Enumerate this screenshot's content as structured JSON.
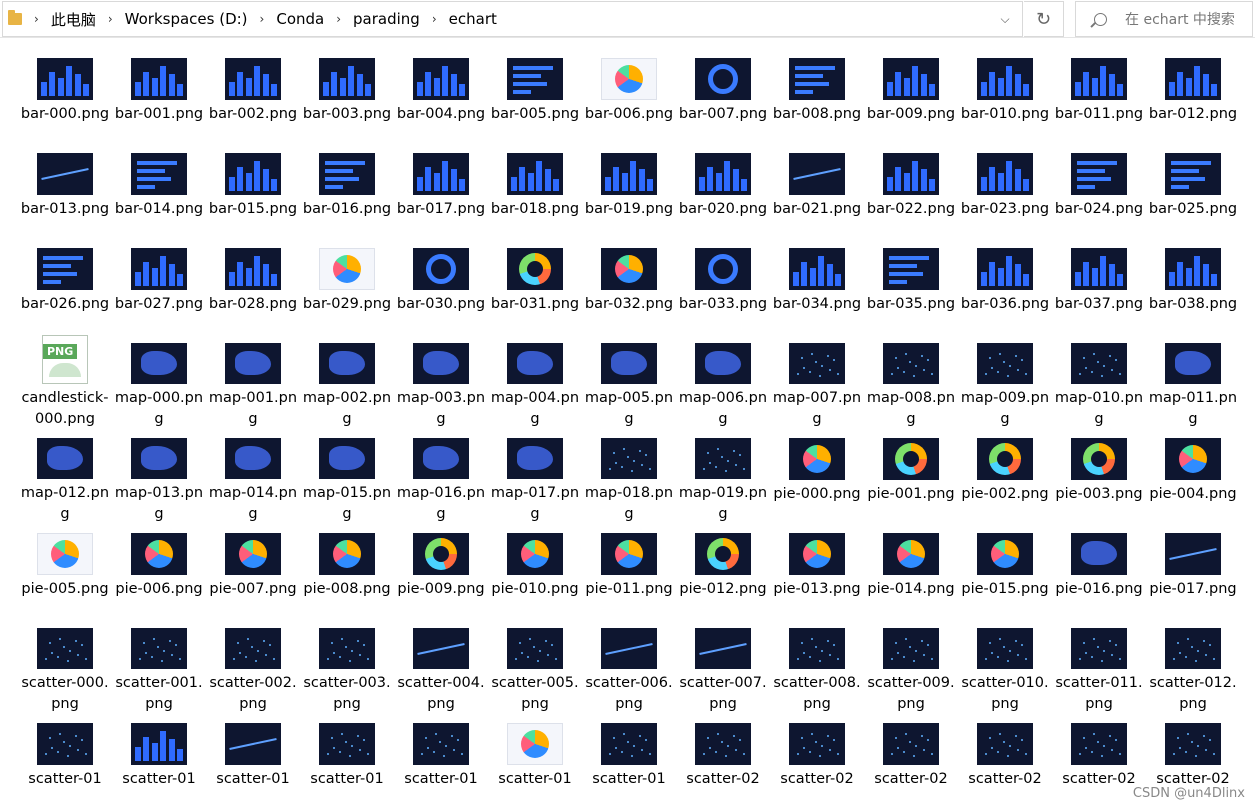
{
  "addressbar": {
    "crumbs": [
      "此电脑",
      "Workspaces (D:)",
      "Conda",
      "parading",
      "echart"
    ]
  },
  "search": {
    "placeholder": "在 echart 中搜索"
  },
  "files": [
    {
      "name": "bar-000.png",
      "kind": "bar"
    },
    {
      "name": "bar-001.png",
      "kind": "bar"
    },
    {
      "name": "bar-002.png",
      "kind": "bar"
    },
    {
      "name": "bar-003.png",
      "kind": "bar"
    },
    {
      "name": "bar-004.png",
      "kind": "bar"
    },
    {
      "name": "bar-005.png",
      "kind": "hbar"
    },
    {
      "name": "bar-006.png",
      "kind": "pie-light"
    },
    {
      "name": "bar-007.png",
      "kind": "ring"
    },
    {
      "name": "bar-008.png",
      "kind": "hbar"
    },
    {
      "name": "bar-009.png",
      "kind": "bar"
    },
    {
      "name": "bar-010.png",
      "kind": "bar"
    },
    {
      "name": "bar-011.png",
      "kind": "bar"
    },
    {
      "name": "bar-012.png",
      "kind": "bar"
    },
    {
      "name": "bar-013.png",
      "kind": "line"
    },
    {
      "name": "bar-014.png",
      "kind": "hbar"
    },
    {
      "name": "bar-015.png",
      "kind": "bar"
    },
    {
      "name": "bar-016.png",
      "kind": "hbar"
    },
    {
      "name": "bar-017.png",
      "kind": "bar"
    },
    {
      "name": "bar-018.png",
      "kind": "bar"
    },
    {
      "name": "bar-019.png",
      "kind": "bar"
    },
    {
      "name": "bar-020.png",
      "kind": "bar"
    },
    {
      "name": "bar-021.png",
      "kind": "line"
    },
    {
      "name": "bar-022.png",
      "kind": "bar"
    },
    {
      "name": "bar-023.png",
      "kind": "bar"
    },
    {
      "name": "bar-024.png",
      "kind": "hbar"
    },
    {
      "name": "bar-025.png",
      "kind": "hbar"
    },
    {
      "name": "bar-026.png",
      "kind": "hbar"
    },
    {
      "name": "bar-027.png",
      "kind": "bar"
    },
    {
      "name": "bar-028.png",
      "kind": "bar"
    },
    {
      "name": "bar-029.png",
      "kind": "pie-light"
    },
    {
      "name": "bar-030.png",
      "kind": "ring"
    },
    {
      "name": "bar-031.png",
      "kind": "donut"
    },
    {
      "name": "bar-032.png",
      "kind": "pie"
    },
    {
      "name": "bar-033.png",
      "kind": "ring"
    },
    {
      "name": "bar-034.png",
      "kind": "bar"
    },
    {
      "name": "bar-035.png",
      "kind": "hbar"
    },
    {
      "name": "bar-036.png",
      "kind": "bar"
    },
    {
      "name": "bar-037.png",
      "kind": "bar"
    },
    {
      "name": "bar-038.png",
      "kind": "bar"
    },
    {
      "name": "candlestick-000.png",
      "kind": "file"
    },
    {
      "name": "map-000.png",
      "kind": "map"
    },
    {
      "name": "map-001.png",
      "kind": "map"
    },
    {
      "name": "map-002.png",
      "kind": "map"
    },
    {
      "name": "map-003.png",
      "kind": "map"
    },
    {
      "name": "map-004.png",
      "kind": "map"
    },
    {
      "name": "map-005.png",
      "kind": "map"
    },
    {
      "name": "map-006.png",
      "kind": "map"
    },
    {
      "name": "map-007.png",
      "kind": "dots"
    },
    {
      "name": "map-008.png",
      "kind": "dots"
    },
    {
      "name": "map-009.png",
      "kind": "dots"
    },
    {
      "name": "map-010.png",
      "kind": "dots"
    },
    {
      "name": "map-011.png",
      "kind": "map"
    },
    {
      "name": "map-012.png",
      "kind": "map"
    },
    {
      "name": "map-013.png",
      "kind": "map"
    },
    {
      "name": "map-014.png",
      "kind": "map"
    },
    {
      "name": "map-015.png",
      "kind": "map"
    },
    {
      "name": "map-016.png",
      "kind": "map"
    },
    {
      "name": "map-017.png",
      "kind": "map"
    },
    {
      "name": "map-018.png",
      "kind": "dots"
    },
    {
      "name": "map-019.png",
      "kind": "dots"
    },
    {
      "name": "pie-000.png",
      "kind": "pie"
    },
    {
      "name": "pie-001.png",
      "kind": "donut"
    },
    {
      "name": "pie-002.png",
      "kind": "donut"
    },
    {
      "name": "pie-003.png",
      "kind": "donut"
    },
    {
      "name": "pie-004.png",
      "kind": "pie"
    },
    {
      "name": "pie-005.png",
      "kind": "pie-light"
    },
    {
      "name": "pie-006.png",
      "kind": "pie"
    },
    {
      "name": "pie-007.png",
      "kind": "pie"
    },
    {
      "name": "pie-008.png",
      "kind": "pie"
    },
    {
      "name": "pie-009.png",
      "kind": "donut"
    },
    {
      "name": "pie-010.png",
      "kind": "pie"
    },
    {
      "name": "pie-011.png",
      "kind": "pie"
    },
    {
      "name": "pie-012.png",
      "kind": "donut"
    },
    {
      "name": "pie-013.png",
      "kind": "pie"
    },
    {
      "name": "pie-014.png",
      "kind": "pie"
    },
    {
      "name": "pie-015.png",
      "kind": "pie"
    },
    {
      "name": "pie-016.png",
      "kind": "map"
    },
    {
      "name": "pie-017.png",
      "kind": "line"
    },
    {
      "name": "scatter-000.png",
      "kind": "dots"
    },
    {
      "name": "scatter-001.png",
      "kind": "dots"
    },
    {
      "name": "scatter-002.png",
      "kind": "dots"
    },
    {
      "name": "scatter-003.png",
      "kind": "dots"
    },
    {
      "name": "scatter-004.png",
      "kind": "line"
    },
    {
      "name": "scatter-005.png",
      "kind": "dots"
    },
    {
      "name": "scatter-006.png",
      "kind": "line"
    },
    {
      "name": "scatter-007.png",
      "kind": "line"
    },
    {
      "name": "scatter-008.png",
      "kind": "dots"
    },
    {
      "name": "scatter-009.png",
      "kind": "dots"
    },
    {
      "name": "scatter-010.png",
      "kind": "dots"
    },
    {
      "name": "scatter-011.png",
      "kind": "dots"
    },
    {
      "name": "scatter-012.png",
      "kind": "dots"
    },
    {
      "name": "scatter-01",
      "kind": "dots"
    },
    {
      "name": "scatter-01",
      "kind": "bar"
    },
    {
      "name": "scatter-01",
      "kind": "line"
    },
    {
      "name": "scatter-01",
      "kind": "dots"
    },
    {
      "name": "scatter-01",
      "kind": "dots"
    },
    {
      "name": "scatter-01",
      "kind": "pie-light"
    },
    {
      "name": "scatter-01",
      "kind": "dots"
    },
    {
      "name": "scatter-02",
      "kind": "dots"
    },
    {
      "name": "scatter-02",
      "kind": "dots"
    },
    {
      "name": "scatter-02",
      "kind": "dots"
    },
    {
      "name": "scatter-02",
      "kind": "dots"
    },
    {
      "name": "scatter-02",
      "kind": "dots"
    },
    {
      "name": "scatter-02",
      "kind": "dots"
    }
  ],
  "watermark": "CSDN @un4Dlinx"
}
